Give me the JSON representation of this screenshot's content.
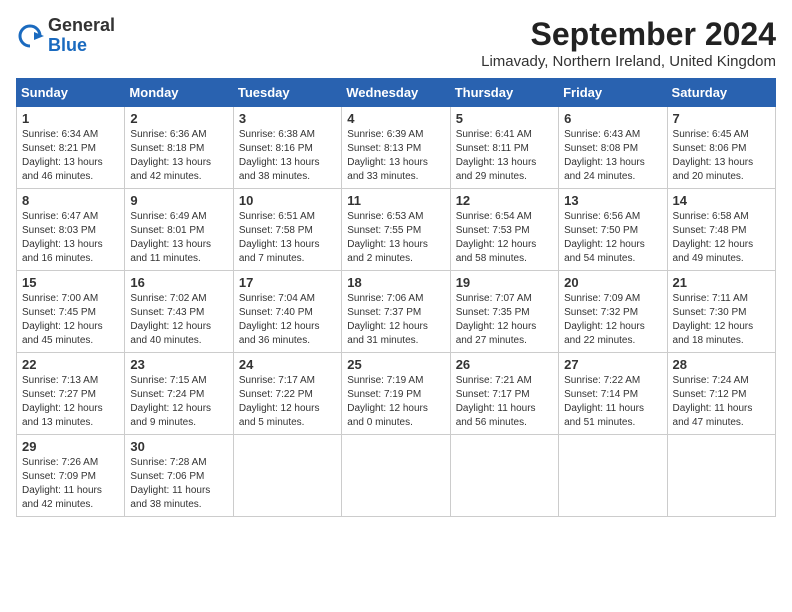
{
  "logo": {
    "general": "General",
    "blue": "Blue"
  },
  "header": {
    "month_year": "September 2024",
    "location": "Limavady, Northern Ireland, United Kingdom"
  },
  "days_of_week": [
    "Sunday",
    "Monday",
    "Tuesday",
    "Wednesday",
    "Thursday",
    "Friday",
    "Saturday"
  ],
  "weeks": [
    [
      {
        "day": "1",
        "sunrise": "6:34 AM",
        "sunset": "8:21 PM",
        "daylight": "13 hours and 46 minutes."
      },
      {
        "day": "2",
        "sunrise": "6:36 AM",
        "sunset": "8:18 PM",
        "daylight": "13 hours and 42 minutes."
      },
      {
        "day": "3",
        "sunrise": "6:38 AM",
        "sunset": "8:16 PM",
        "daylight": "13 hours and 38 minutes."
      },
      {
        "day": "4",
        "sunrise": "6:39 AM",
        "sunset": "8:13 PM",
        "daylight": "13 hours and 33 minutes."
      },
      {
        "day": "5",
        "sunrise": "6:41 AM",
        "sunset": "8:11 PM",
        "daylight": "13 hours and 29 minutes."
      },
      {
        "day": "6",
        "sunrise": "6:43 AM",
        "sunset": "8:08 PM",
        "daylight": "13 hours and 24 minutes."
      },
      {
        "day": "7",
        "sunrise": "6:45 AM",
        "sunset": "8:06 PM",
        "daylight": "13 hours and 20 minutes."
      }
    ],
    [
      {
        "day": "8",
        "sunrise": "6:47 AM",
        "sunset": "8:03 PM",
        "daylight": "13 hours and 16 minutes."
      },
      {
        "day": "9",
        "sunrise": "6:49 AM",
        "sunset": "8:01 PM",
        "daylight": "13 hours and 11 minutes."
      },
      {
        "day": "10",
        "sunrise": "6:51 AM",
        "sunset": "7:58 PM",
        "daylight": "13 hours and 7 minutes."
      },
      {
        "day": "11",
        "sunrise": "6:53 AM",
        "sunset": "7:55 PM",
        "daylight": "13 hours and 2 minutes."
      },
      {
        "day": "12",
        "sunrise": "6:54 AM",
        "sunset": "7:53 PM",
        "daylight": "12 hours and 58 minutes."
      },
      {
        "day": "13",
        "sunrise": "6:56 AM",
        "sunset": "7:50 PM",
        "daylight": "12 hours and 54 minutes."
      },
      {
        "day": "14",
        "sunrise": "6:58 AM",
        "sunset": "7:48 PM",
        "daylight": "12 hours and 49 minutes."
      }
    ],
    [
      {
        "day": "15",
        "sunrise": "7:00 AM",
        "sunset": "7:45 PM",
        "daylight": "12 hours and 45 minutes."
      },
      {
        "day": "16",
        "sunrise": "7:02 AM",
        "sunset": "7:43 PM",
        "daylight": "12 hours and 40 minutes."
      },
      {
        "day": "17",
        "sunrise": "7:04 AM",
        "sunset": "7:40 PM",
        "daylight": "12 hours and 36 minutes."
      },
      {
        "day": "18",
        "sunrise": "7:06 AM",
        "sunset": "7:37 PM",
        "daylight": "12 hours and 31 minutes."
      },
      {
        "day": "19",
        "sunrise": "7:07 AM",
        "sunset": "7:35 PM",
        "daylight": "12 hours and 27 minutes."
      },
      {
        "day": "20",
        "sunrise": "7:09 AM",
        "sunset": "7:32 PM",
        "daylight": "12 hours and 22 minutes."
      },
      {
        "day": "21",
        "sunrise": "7:11 AM",
        "sunset": "7:30 PM",
        "daylight": "12 hours and 18 minutes."
      }
    ],
    [
      {
        "day": "22",
        "sunrise": "7:13 AM",
        "sunset": "7:27 PM",
        "daylight": "12 hours and 13 minutes."
      },
      {
        "day": "23",
        "sunrise": "7:15 AM",
        "sunset": "7:24 PM",
        "daylight": "12 hours and 9 minutes."
      },
      {
        "day": "24",
        "sunrise": "7:17 AM",
        "sunset": "7:22 PM",
        "daylight": "12 hours and 5 minutes."
      },
      {
        "day": "25",
        "sunrise": "7:19 AM",
        "sunset": "7:19 PM",
        "daylight": "12 hours and 0 minutes."
      },
      {
        "day": "26",
        "sunrise": "7:21 AM",
        "sunset": "7:17 PM",
        "daylight": "11 hours and 56 minutes."
      },
      {
        "day": "27",
        "sunrise": "7:22 AM",
        "sunset": "7:14 PM",
        "daylight": "11 hours and 51 minutes."
      },
      {
        "day": "28",
        "sunrise": "7:24 AM",
        "sunset": "7:12 PM",
        "daylight": "11 hours and 47 minutes."
      }
    ],
    [
      {
        "day": "29",
        "sunrise": "7:26 AM",
        "sunset": "7:09 PM",
        "daylight": "11 hours and 42 minutes."
      },
      {
        "day": "30",
        "sunrise": "7:28 AM",
        "sunset": "7:06 PM",
        "daylight": "11 hours and 38 minutes."
      },
      null,
      null,
      null,
      null,
      null
    ]
  ]
}
